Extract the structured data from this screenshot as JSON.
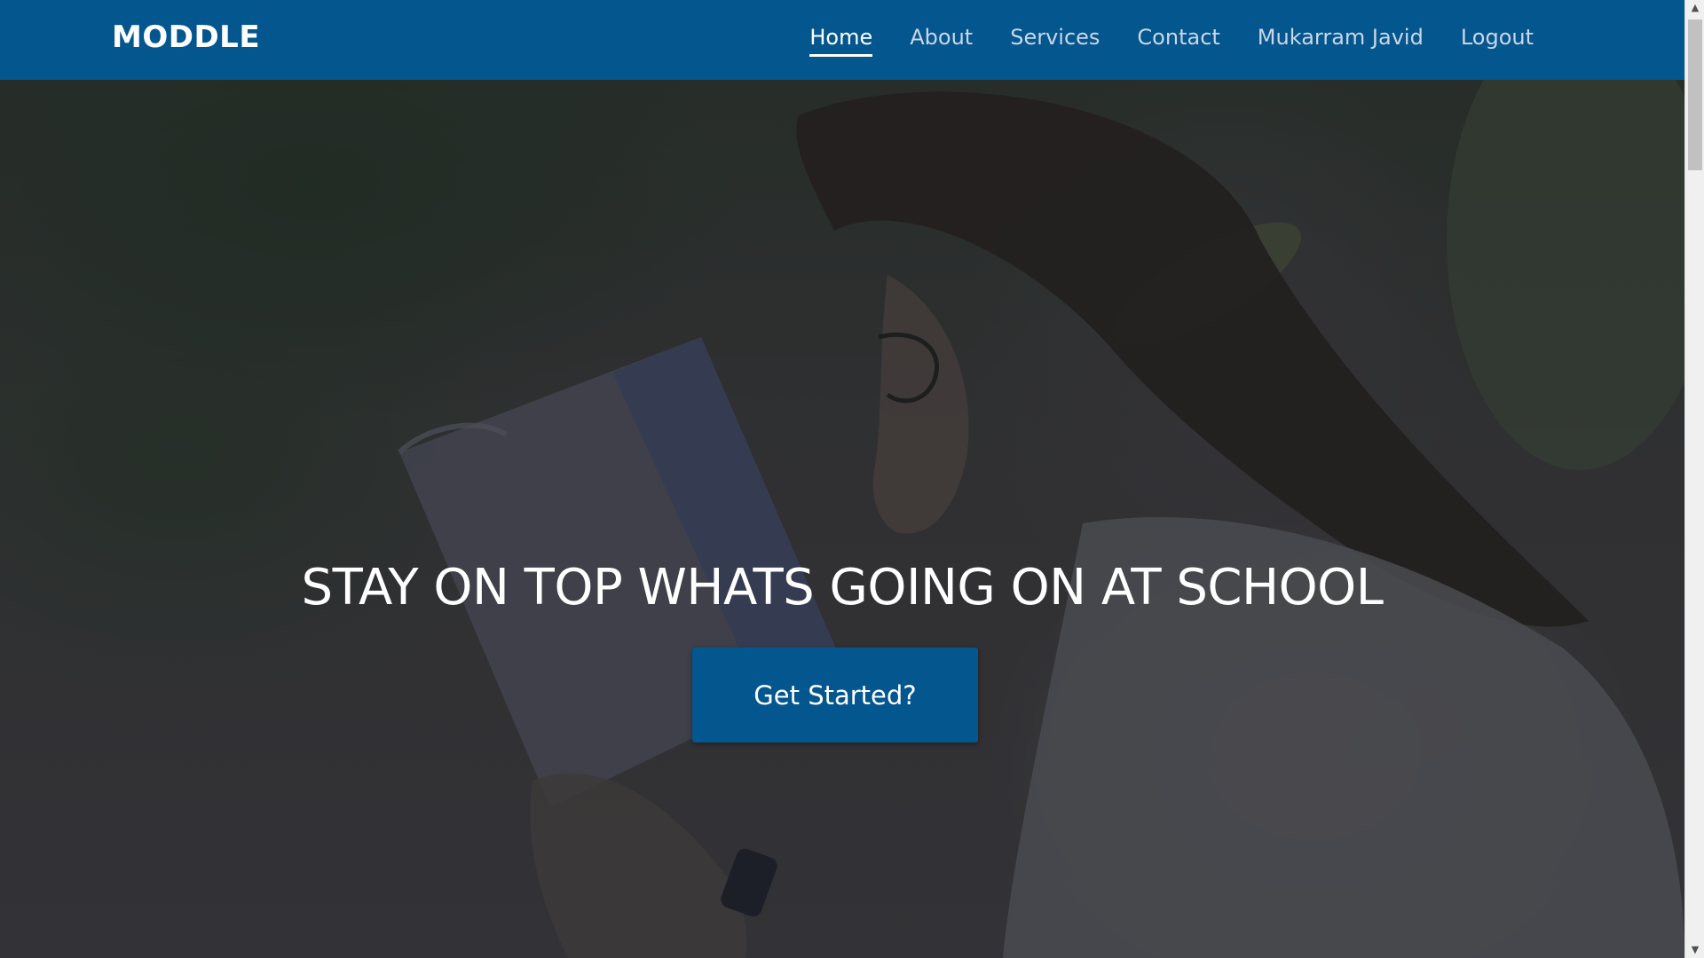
{
  "navbar": {
    "brand": "MODDLE",
    "links": [
      {
        "label": "Home",
        "active": true
      },
      {
        "label": "About",
        "active": false
      },
      {
        "label": "Services",
        "active": false
      },
      {
        "label": "Contact",
        "active": false
      },
      {
        "label": "Mukarram Javid",
        "active": false
      },
      {
        "label": "Logout",
        "active": false
      }
    ]
  },
  "hero": {
    "title": "STAY ON TOP WHATS GOING ON AT SCHOOL",
    "cta_label": "Get Started?"
  },
  "colors": {
    "primary": "#04568f",
    "text_light": "#ffffff",
    "nav_link": "#c9d7e6"
  },
  "scrollbar": {
    "up_icon": "chevron-up-icon",
    "down_icon": "chevron-down-icon"
  }
}
